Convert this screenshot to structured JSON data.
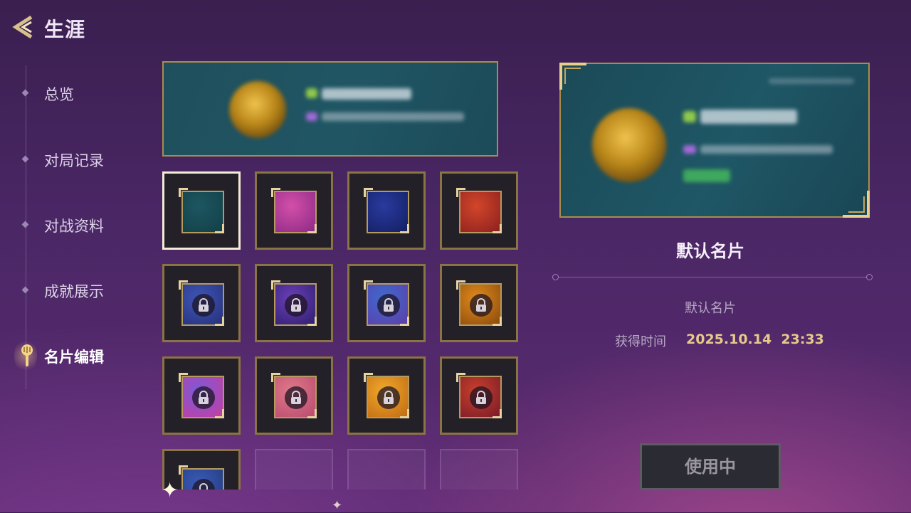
{
  "header": {
    "title": "生涯"
  },
  "sidebar": {
    "items": [
      {
        "label": "总览",
        "active": false
      },
      {
        "label": "对局记录",
        "active": false
      },
      {
        "label": "对战资料",
        "active": false
      },
      {
        "label": "成就展示",
        "active": false
      },
      {
        "label": "名片编辑",
        "active": true
      }
    ]
  },
  "cards": [
    {
      "theme": "teal",
      "colors": [
        "#1d5660",
        "#124048"
      ],
      "locked": false,
      "selected": true
    },
    {
      "theme": "pink-music",
      "colors": [
        "#d34fa8",
        "#8c2a86"
      ],
      "locked": false,
      "selected": false
    },
    {
      "theme": "blue",
      "colors": [
        "#2a3a9e",
        "#121f62"
      ],
      "locked": false,
      "selected": false
    },
    {
      "theme": "red",
      "colors": [
        "#d2462a",
        "#8c1f1e"
      ],
      "locked": false,
      "selected": false
    },
    {
      "theme": "blue-dragon",
      "colors": [
        "#3e56b8",
        "#26307a"
      ],
      "locked": true,
      "selected": false
    },
    {
      "theme": "violet-cosmic",
      "colors": [
        "#6b3fb8",
        "#2e1f6e"
      ],
      "locked": true,
      "selected": false
    },
    {
      "theme": "ocean-swirl",
      "colors": [
        "#3d6ad0",
        "#5e3ea8"
      ],
      "locked": true,
      "selected": false
    },
    {
      "theme": "amber",
      "colors": [
        "#e08a1c",
        "#8a4a0c"
      ],
      "locked": true,
      "selected": false
    },
    {
      "theme": "purple-pink",
      "colors": [
        "#7a5ad8",
        "#c63ea0"
      ],
      "locked": true,
      "selected": false
    },
    {
      "theme": "rose-pink",
      "colors": [
        "#e07a8a",
        "#b84a6e"
      ],
      "locked": true,
      "selected": false
    },
    {
      "theme": "gold",
      "colors": [
        "#f0a92a",
        "#c06a14"
      ],
      "locked": true,
      "selected": false
    },
    {
      "theme": "crimson-fox",
      "colors": [
        "#c8402a",
        "#7a1a2a"
      ],
      "locked": true,
      "selected": false
    },
    {
      "theme": "navy-cloud",
      "colors": [
        "#3a5ab8",
        "#223a7a"
      ],
      "locked": true,
      "selected": false
    },
    {
      "theme": "empty",
      "locked": false,
      "selected": false
    },
    {
      "theme": "empty",
      "locked": false,
      "selected": false
    },
    {
      "theme": "empty",
      "locked": false,
      "selected": false
    }
  ],
  "detail": {
    "name": "默认名片",
    "description": "默认名片",
    "time_label": "获得时间",
    "time_value": "2025.10.14  23:33",
    "use_button_label": "使用中"
  },
  "colors": {
    "gold_border": "#a88d4c",
    "accent_gold_text": "#e7c98a",
    "background": "#4b2766"
  }
}
